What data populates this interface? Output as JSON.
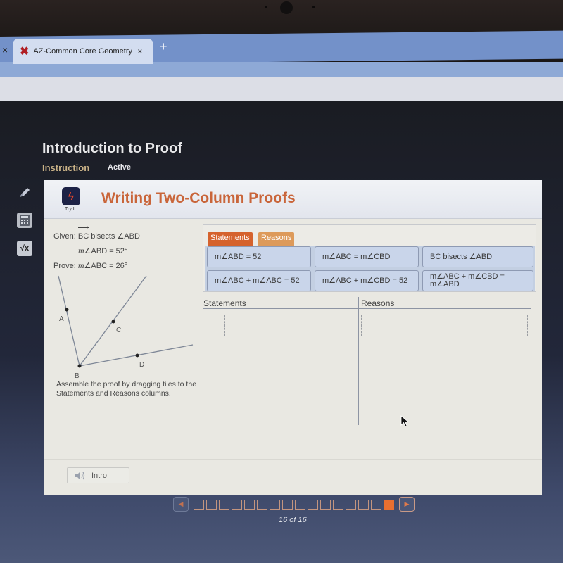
{
  "browser": {
    "prev_tab_close": "×",
    "active_tab": {
      "favicon": "red-x-logo",
      "title": "AZ-Common Core Geometry A - |",
      "close": "×"
    },
    "new_tab": "+"
  },
  "course": {
    "title": "Introduction to Proof",
    "nav": {
      "instruction": "Instruction",
      "status": "Active"
    }
  },
  "tools": [
    {
      "name": "pencil-icon"
    },
    {
      "name": "calculator-icon"
    },
    {
      "name": "formula-icon",
      "label": "√x"
    }
  ],
  "activity": {
    "badge": {
      "icon": "lightning-icon",
      "label": "Try It",
      "color": "#1d2246",
      "accent": "#e0452b"
    },
    "title": "Writing Two-Column Proofs",
    "title_color": "#c9653a",
    "given_label": "Given:",
    "given_vector": "BC",
    "given_text": " bisects ∠ABD",
    "given_m": "m",
    "given_2": "∠ABD = 52°",
    "prove_label": "Prove: ",
    "prove_m": "m",
    "prove_text": "∠ABC = 26°",
    "diagram": {
      "points": [
        {
          "label": "A"
        },
        {
          "label": "B"
        },
        {
          "label": "C"
        },
        {
          "label": "D"
        }
      ]
    },
    "instructions": "Assemble the proof by dragging tiles to the Statements and Reasons columns."
  },
  "bank": {
    "tabs": [
      {
        "label": "Statements",
        "active": true,
        "color": "#d5622d"
      },
      {
        "label": "Reasons",
        "active": false,
        "color": "#dd9a5a"
      }
    ],
    "tiles": [
      {
        "text": "m∠ABD = 52"
      },
      {
        "text": "m∠ABC = m∠CBD"
      },
      {
        "text": "BC bisects ∠ABD",
        "vector": "BC"
      },
      {
        "text": "m∠ABC + m∠ABC = 52"
      },
      {
        "text": "m∠ABC + m∠CBD = 52"
      },
      {
        "text": "m∠ABC + m∠CBD = m∠ABD"
      }
    ]
  },
  "proof_table": {
    "statements_header": "Statements",
    "reasons_header": "Reasons"
  },
  "footer": {
    "intro_button": "Intro"
  },
  "pager": {
    "current": 16,
    "total": 16,
    "label": "16 of 16",
    "prev": "◀",
    "next": "▶",
    "accent": "#e86f30"
  }
}
